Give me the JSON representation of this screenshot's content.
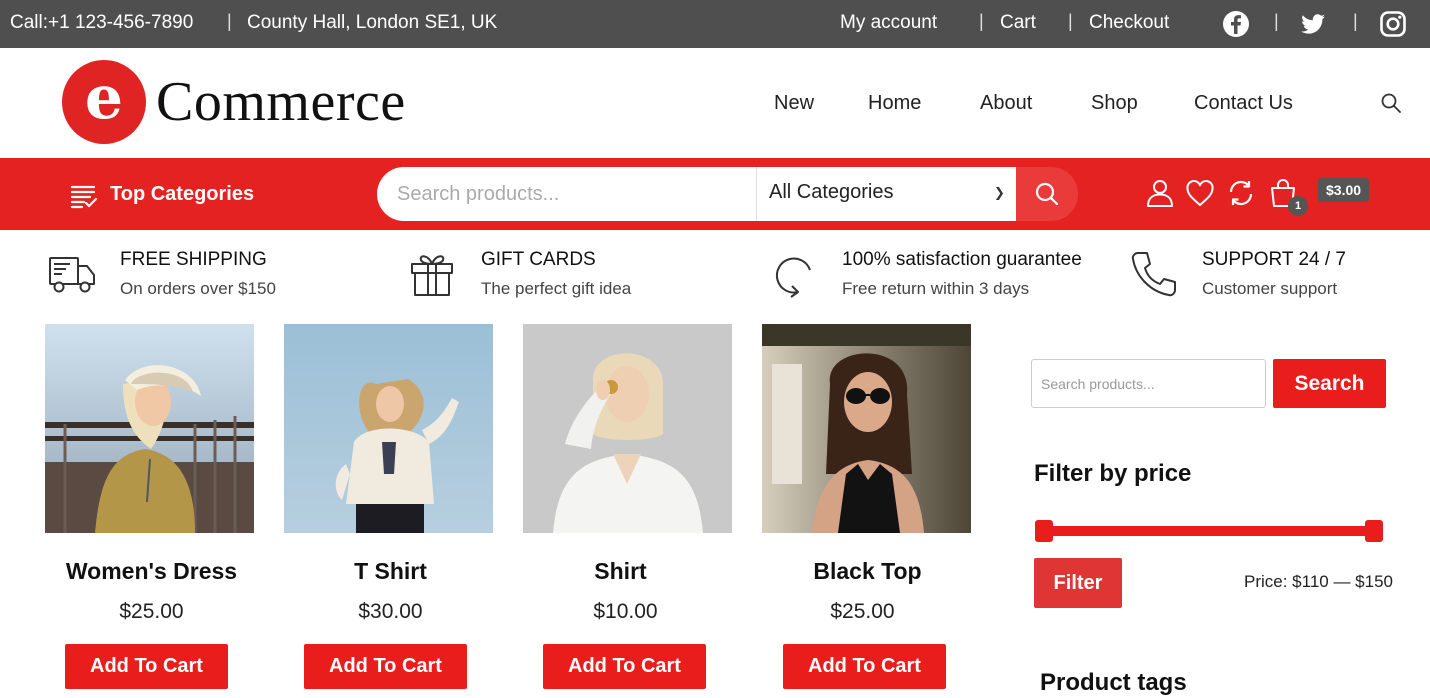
{
  "topbar": {
    "call": "Call:+1 123-456-7890",
    "sep1": "|",
    "address": "County Hall, London SE1, UK",
    "my_account": "My account",
    "sep2": "|",
    "cart": "Cart",
    "sep3": "|",
    "checkout": "Checkout",
    "social_sep1": "|",
    "social_sep2": "|",
    "social_icons": [
      "facebook-icon",
      "twitter-icon",
      "instagram-icon"
    ]
  },
  "header": {
    "logo_letter": "e",
    "logo_text": "Commerce",
    "nav": [
      "New",
      "Home",
      "About",
      "Shop",
      "Contact Us"
    ]
  },
  "redbar": {
    "top_categories": "Top Categories",
    "search_placeholder": "Search products...",
    "category_select": "All Categories",
    "cart_count": "1",
    "cart_total": "$3.00"
  },
  "features": [
    {
      "icon": "truck-icon",
      "title": "FREE SHIPPING",
      "subtitle": "On orders over $150"
    },
    {
      "icon": "gift-icon",
      "title": "GIFT CARDS",
      "subtitle": "The perfect gift idea"
    },
    {
      "icon": "refresh-icon",
      "title": "100% satisfaction guarantee",
      "subtitle": "Free return within 3 days"
    },
    {
      "icon": "phone-icon",
      "title": "SUPPORT 24 / 7",
      "subtitle": "Customer support"
    }
  ],
  "products": [
    {
      "name": "Women's Dress",
      "price": "$25.00",
      "button": "Add To Cart"
    },
    {
      "name": "T Shirt",
      "price": "$30.00",
      "button": "Add To Cart"
    },
    {
      "name": "Shirt",
      "price": "$10.00",
      "button": "Add To Cart"
    },
    {
      "name": "Black Top",
      "price": "$25.00",
      "button": "Add To Cart"
    }
  ],
  "sidebar": {
    "search_placeholder": "Search products...",
    "search_button": "Search",
    "filter_title": "Filter by price",
    "filter_button": "Filter",
    "price_range": "Price: $110 — $150",
    "price_min": 110,
    "price_max": 150,
    "tags_title": "Product tags"
  },
  "colors": {
    "brand_red": "#e52222",
    "topbar_gray": "#4f4f4f"
  }
}
